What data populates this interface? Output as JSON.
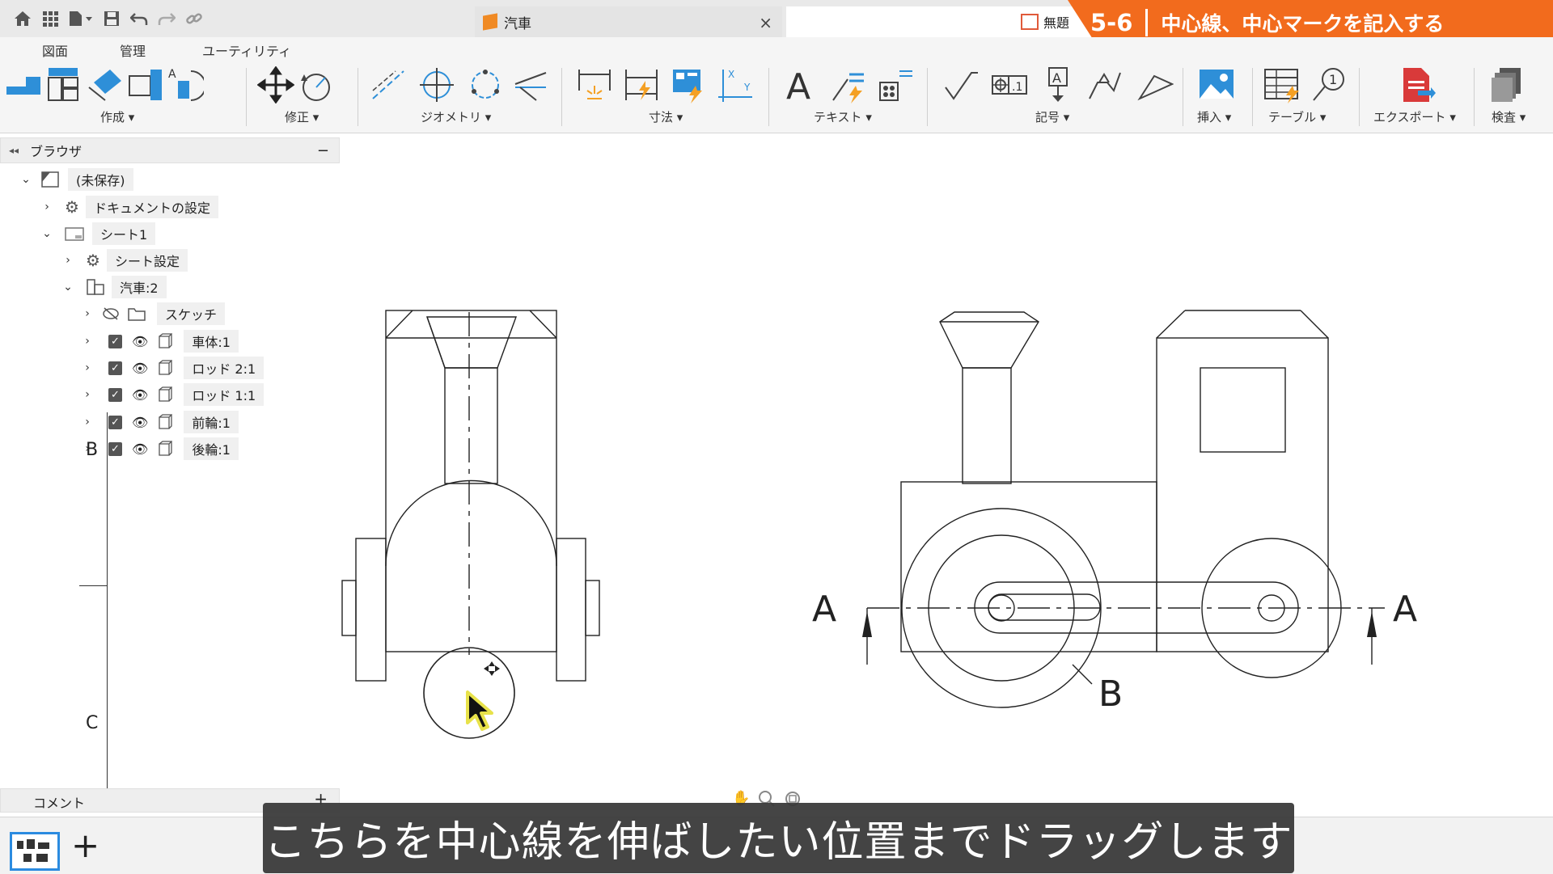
{
  "window": {
    "doc_tab_label": "汽車",
    "doc_tab2_label": "無題",
    "doc_tab_close": "×"
  },
  "banner": {
    "number": "5-6",
    "title": "中心線、中心マークを記入する"
  },
  "ribbon_tabs": [
    "図面",
    "管理",
    "ユーティリティ"
  ],
  "ribbon_groups": {
    "create": "作成 ▾",
    "modify": "修正 ▾",
    "geometry": "ジオメトリ ▾",
    "dimension": "寸法 ▾",
    "text": "テキスト ▾",
    "symbol": "記号 ▾",
    "insert": "挿入 ▾",
    "table": "テーブル ▾",
    "export": "エクスポート ▾",
    "inspect": "検査 ▾"
  },
  "browser": {
    "title": "ブラウザ",
    "collapse": "−",
    "items": [
      {
        "label": "(未保存)"
      },
      {
        "label": "ドキュメントの設定"
      },
      {
        "label": "シート1"
      },
      {
        "label": "シート設定"
      },
      {
        "label": "汽車:2"
      },
      {
        "label": "スケッチ"
      },
      {
        "label": "車体:1"
      },
      {
        "label": "ロッド 2:1"
      },
      {
        "label": "ロッド 1:1"
      },
      {
        "label": "前輪:1"
      },
      {
        "label": "後輪:1"
      }
    ]
  },
  "sheet_markers": {
    "b": "B",
    "c": "C"
  },
  "drawing": {
    "section_label_left": "A",
    "section_label_right": "A",
    "detail_label": "B"
  },
  "comments": {
    "label": "コメント",
    "add": "+"
  },
  "bottom": {
    "add_sheet": "+"
  },
  "subtitle": "こちらを中心線を伸ばしたい位置までドラッグします",
  "colors": {
    "accent": "#f26b1d",
    "icon_blue": "#2e8fd8",
    "icon_orange": "#f4a024",
    "export_red": "#d93a3a"
  }
}
